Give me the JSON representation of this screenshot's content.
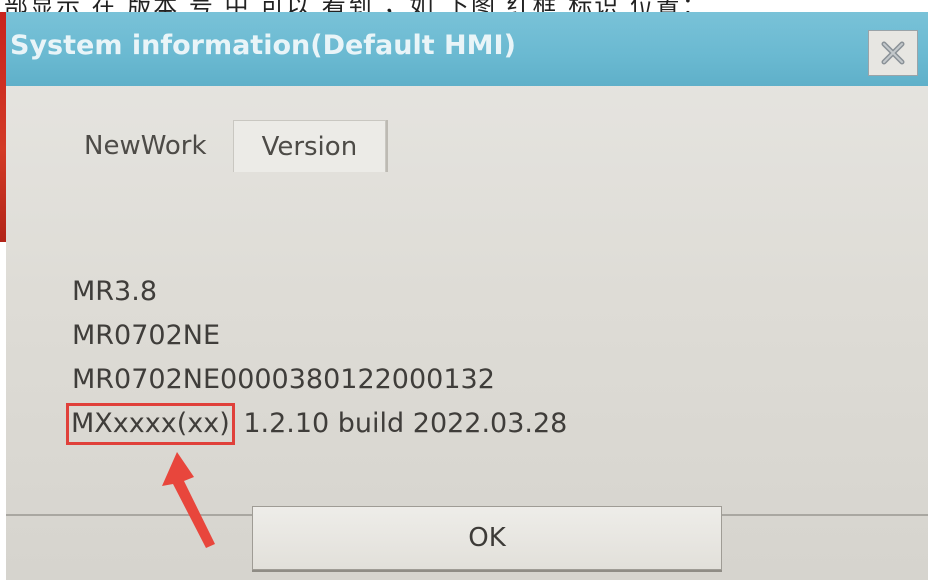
{
  "caption_strip": "部显示 在 版本 号 中 可以 看到 ，如 下图 红框 标识 位置：",
  "dialog": {
    "title": "System information(Default HMI)",
    "close_icon": "close-x-icon"
  },
  "tabs": [
    {
      "label": "NewWork",
      "active": false
    },
    {
      "label": "Version",
      "active": true
    }
  ],
  "info": {
    "line1": "MR3.8",
    "line2": "MR0702NE",
    "line3": "MR0702NE0000380122000132",
    "model_name": "MXxxxx(xx)",
    "version_text": "1.2.10 build 2022.03.28"
  },
  "ok_label": "OK",
  "colors": {
    "titlebar": "#6ab9d1",
    "dialog_bg": "#e0ded8",
    "highlight_box": "#e0403a",
    "arrow": "#e8463c"
  }
}
